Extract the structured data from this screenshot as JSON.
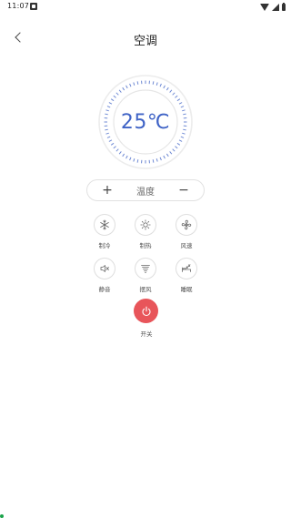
{
  "status_bar": {
    "time": "11:07",
    "notification_icon": "a-box-icon",
    "icons": [
      "wifi-icon",
      "signal-icon",
      "battery-icon"
    ]
  },
  "header": {
    "title": "空调",
    "back_icon": "chevron-left-icon"
  },
  "thermostat": {
    "temperature": "25℃",
    "accent_color": "#3f63c6"
  },
  "temp_control": {
    "plus": "+",
    "label": "温度",
    "minus": "−"
  },
  "functions": [
    {
      "id": "cool",
      "label": "制冷",
      "icon": "snowflake-icon"
    },
    {
      "id": "heat",
      "label": "制热",
      "icon": "sun-icon"
    },
    {
      "id": "fan",
      "label": "风速",
      "icon": "fan-icon"
    },
    {
      "id": "mute",
      "label": "静音",
      "icon": "speaker-mute-icon"
    },
    {
      "id": "swing",
      "label": "摆风",
      "icon": "swing-icon"
    },
    {
      "id": "sleep",
      "label": "睡眠",
      "icon": "sleep-icon"
    }
  ],
  "power": {
    "label": "开关",
    "color": "#e8555a",
    "icon": "power-icon"
  }
}
